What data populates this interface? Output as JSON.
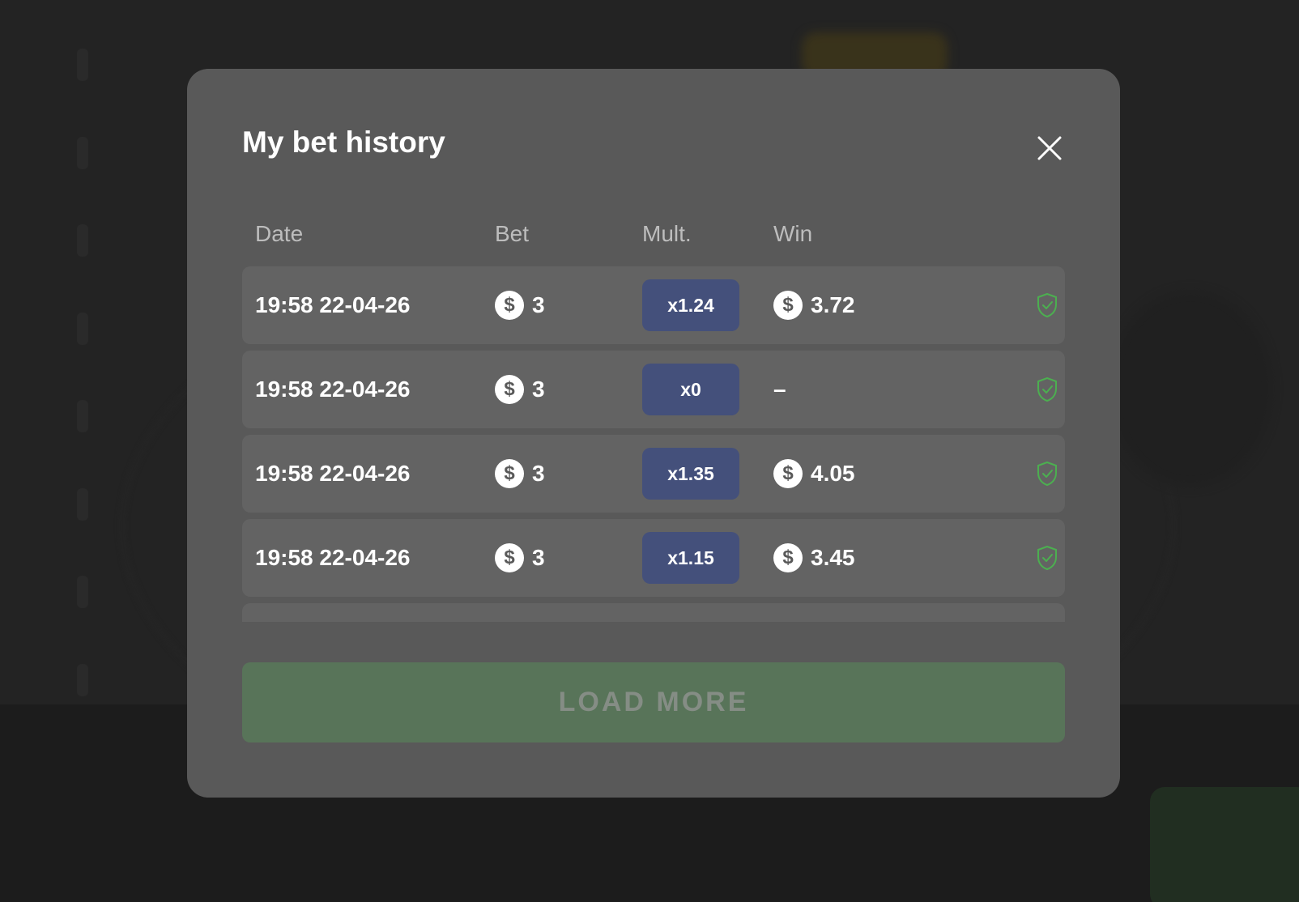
{
  "modal": {
    "title": "My bet history",
    "load_more_label": "LOAD MORE"
  },
  "table": {
    "headers": {
      "date": "Date",
      "bet": "Bet",
      "mult": "Mult.",
      "win": "Win"
    },
    "currency_symbol": "$",
    "rows": [
      {
        "date": "19:58 22-04-26",
        "bet": "3",
        "mult": "x1.24",
        "win": "3.72"
      },
      {
        "date": "19:58 22-04-26",
        "bet": "3",
        "mult": "x0",
        "win": "–"
      },
      {
        "date": "19:58 22-04-26",
        "bet": "3",
        "mult": "x1.35",
        "win": "4.05"
      },
      {
        "date": "19:58 22-04-26",
        "bet": "3",
        "mult": "x1.15",
        "win": "3.45"
      }
    ]
  },
  "colors": {
    "modal_bg": "#595959",
    "row_bg": "#636363",
    "mult_badge": "#44507b",
    "verified_icon": "#4caf50",
    "load_more_bg": "#587459"
  },
  "icons": {
    "close": "close-icon",
    "coin": "dollar-coin-icon",
    "verified": "shield-check-icon"
  }
}
